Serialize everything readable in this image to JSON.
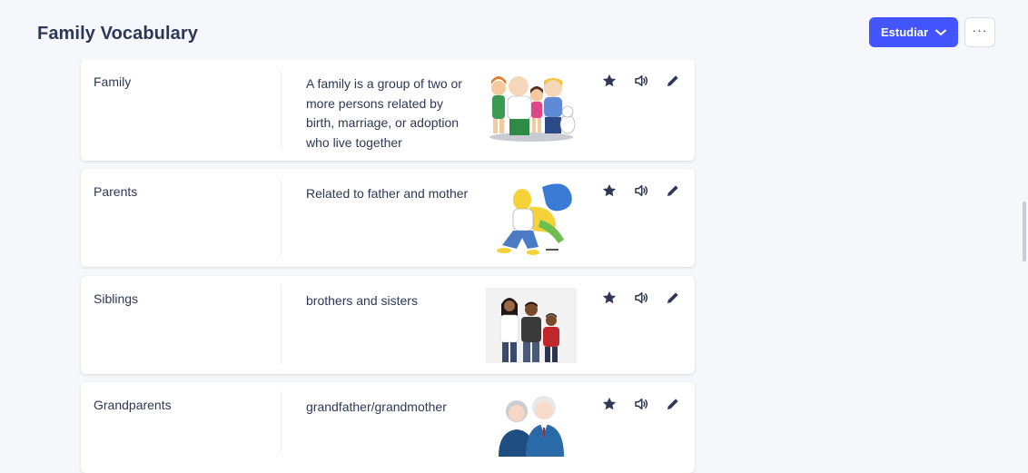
{
  "header": {
    "title": "Family Vocabulary",
    "study_button_label": "Estudiar",
    "more_button_label": "···"
  },
  "cards": [
    {
      "term": "Family",
      "definition": "A family is a group of two or more persons related by birth, marriage, or adoption who live together"
    },
    {
      "term": "Parents",
      "definition": "Related to father and mother"
    },
    {
      "term": "Siblings",
      "definition": "brothers and sisters"
    },
    {
      "term": "Grandparents",
      "definition": "grandfather/grandmother"
    }
  ],
  "icons": {
    "star": "star-icon",
    "audio": "speaker-icon",
    "edit": "pencil-icon",
    "dropdown": "chevron-down-icon"
  },
  "colors": {
    "accent": "#4255ff",
    "text": "#2e3856",
    "background": "#f6f7fb",
    "card": "#ffffff"
  }
}
